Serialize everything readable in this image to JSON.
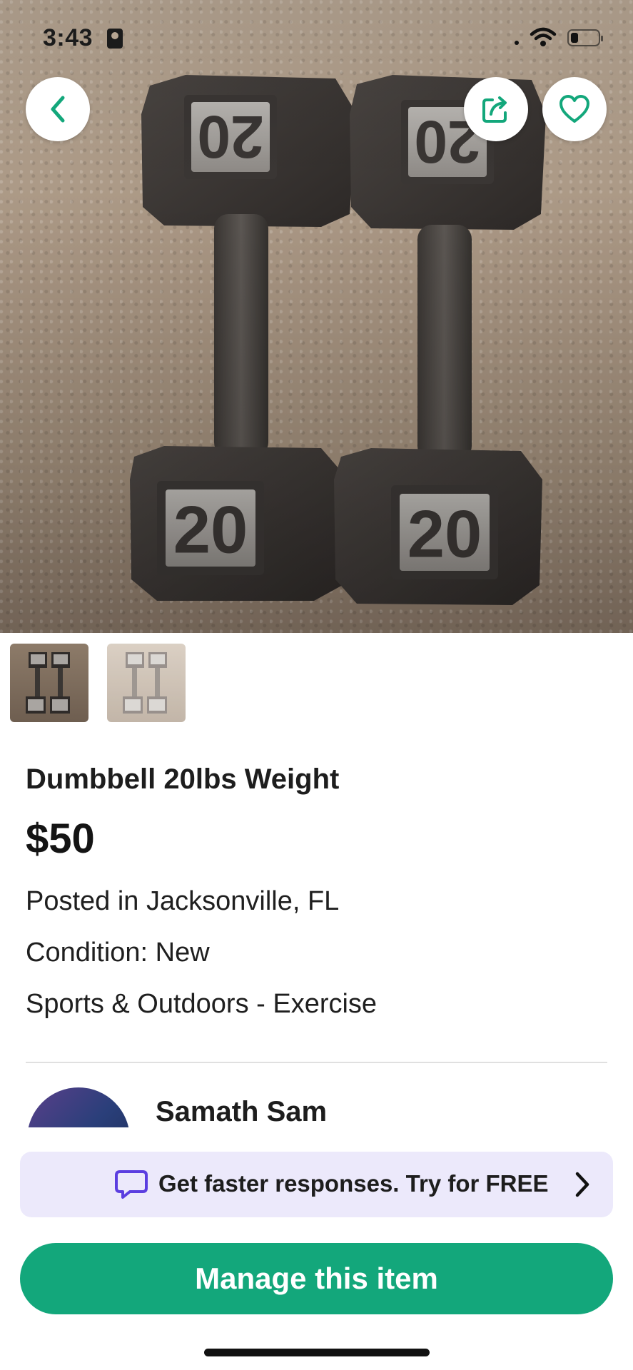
{
  "status_bar": {
    "time": "3:43"
  },
  "hero": {
    "image_alt": "Two 20 lb hex dumbbells on carpet",
    "weight_label_top_left": "20",
    "weight_label_top_right": "20",
    "weight_label_bottom_left": "20",
    "weight_label_bottom_right": "20"
  },
  "header_actions": {
    "back_icon": "chevron-left-icon",
    "share_icon": "share-icon",
    "favorite_icon": "heart-icon"
  },
  "thumbnails": [
    {
      "name": "thumbnail-1",
      "selected": true
    },
    {
      "name": "thumbnail-2",
      "selected": false
    }
  ],
  "listing": {
    "title": "Dumbbell 20lbs Weight",
    "price": "$50",
    "location": "Posted in Jacksonville, FL",
    "condition": "Condition: New",
    "category": "Sports & Outdoors - Exercise"
  },
  "seller": {
    "name": "Samath Sam"
  },
  "promo": {
    "text": "Get faster responses. Try for FREE",
    "icon": "chat-bubble-icon"
  },
  "actions": {
    "manage_label": "Manage this item"
  },
  "colors": {
    "accent_green": "#13a77b",
    "promo_bg": "#ece9fb",
    "promo_icon": "#5b3ee0",
    "text_dark": "#1d1d1d"
  }
}
